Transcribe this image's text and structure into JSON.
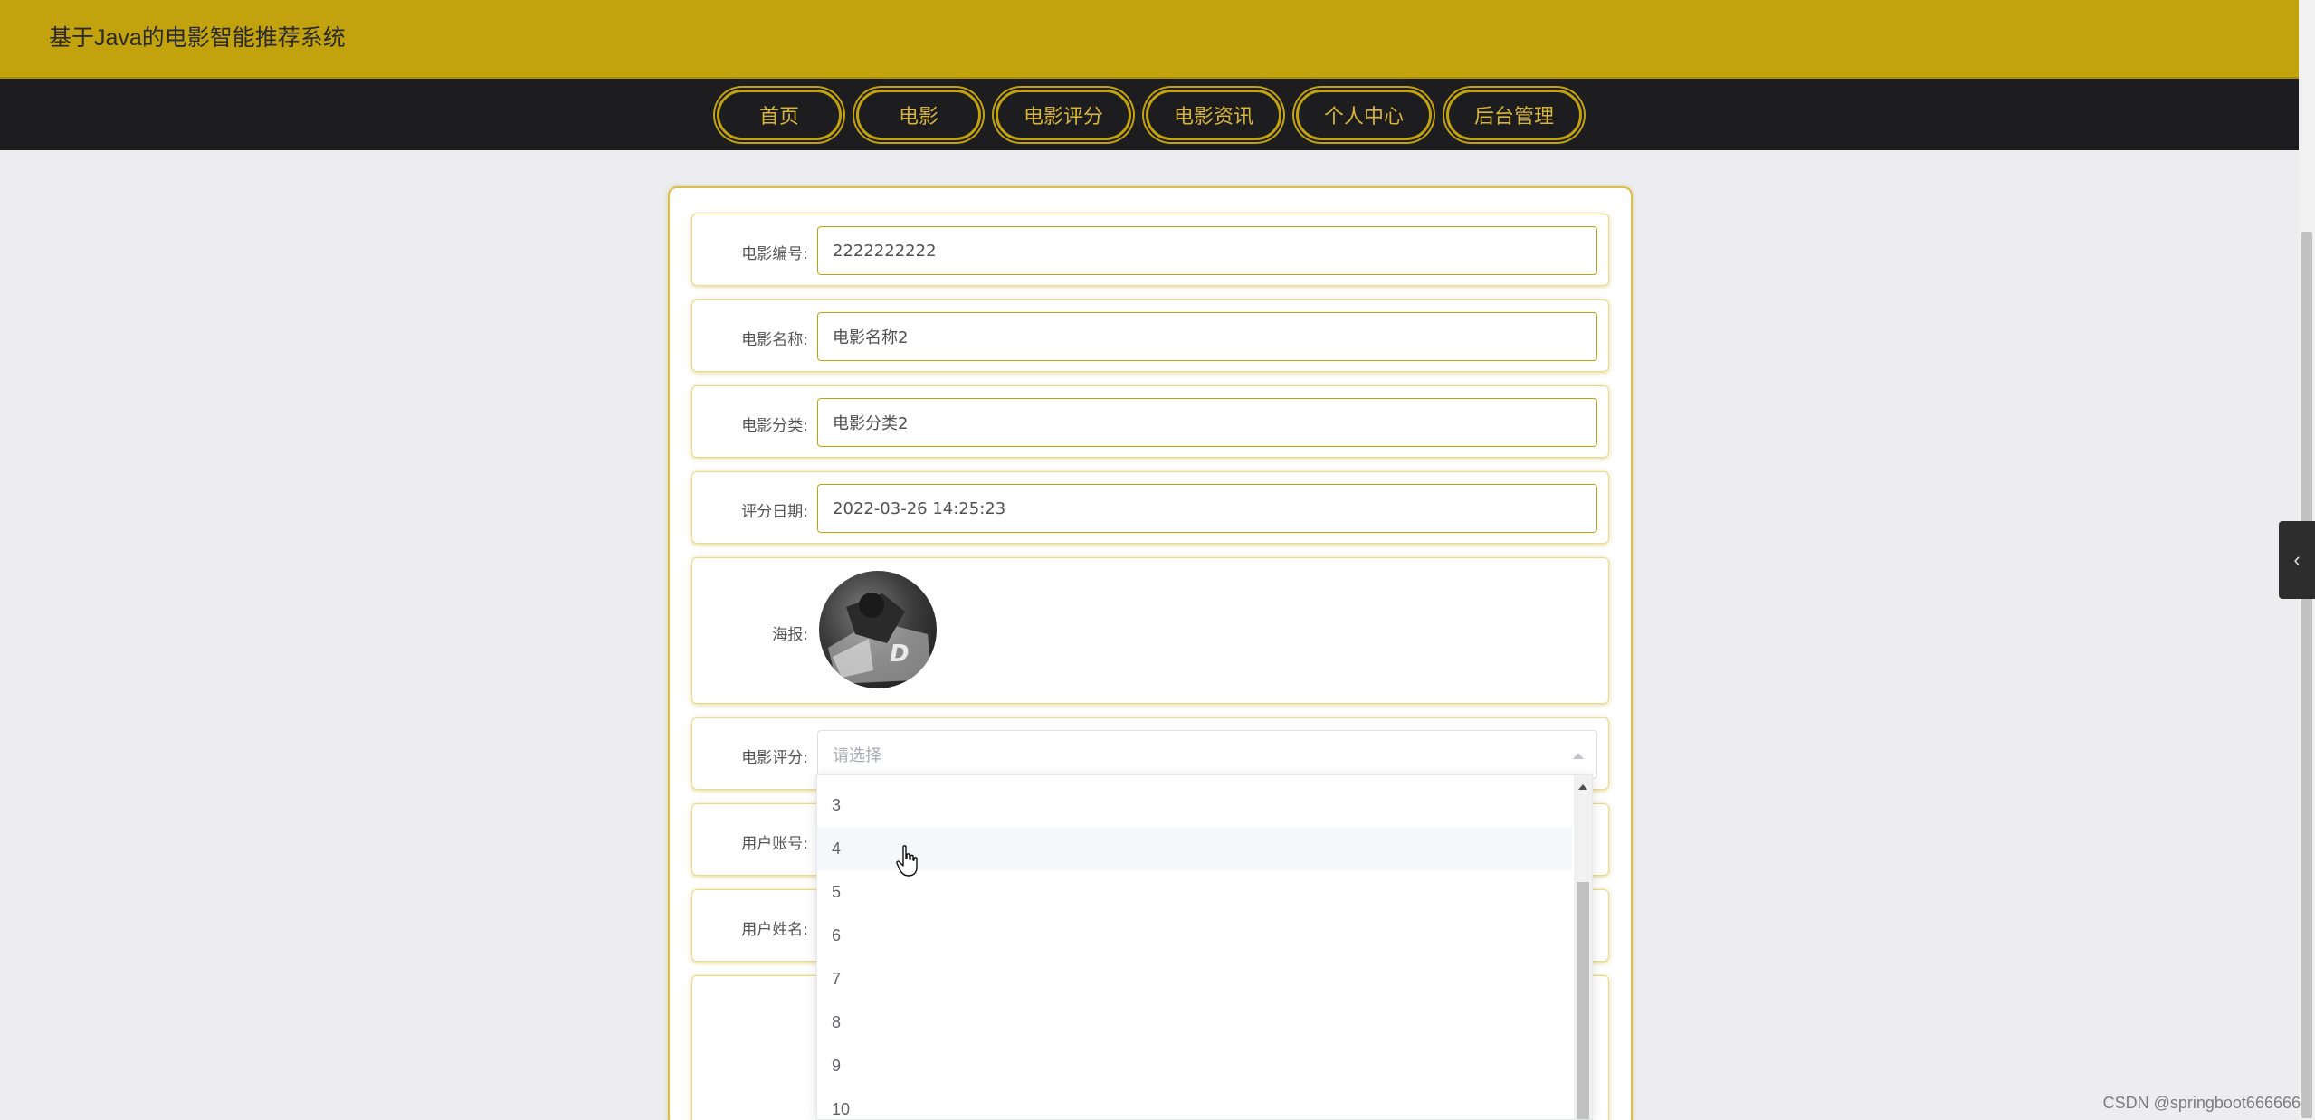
{
  "app": {
    "title": "基于Java的电影智能推荐系统"
  },
  "nav": {
    "items": [
      "首页",
      "电影",
      "电影评分",
      "电影资讯",
      "个人中心",
      "后台管理"
    ]
  },
  "form": {
    "movie_no": {
      "label": "电影编号:",
      "value": "2222222222"
    },
    "movie_name": {
      "label": "电影名称:",
      "value": "电影名称2"
    },
    "movie_category": {
      "label": "电影分类:",
      "value": "电影分类2"
    },
    "rating_date": {
      "label": "评分日期:",
      "value": "2022-03-26 14:25:23"
    },
    "poster": {
      "label": "海报:"
    },
    "movie_rating": {
      "label": "电影评分:",
      "placeholder": "请选择"
    },
    "user_account": {
      "label": "用户账号:"
    },
    "user_name": {
      "label": "用户姓名:"
    }
  },
  "dropdown": {
    "options": [
      "3",
      "4",
      "5",
      "6",
      "7",
      "8",
      "9",
      "10"
    ],
    "hovered": "4"
  },
  "watermark": "CSDN @springboot666666",
  "colors": {
    "accent": "#c2a20d",
    "nav_bg": "#1d1c1e",
    "nav_text": "#d8b53a"
  }
}
